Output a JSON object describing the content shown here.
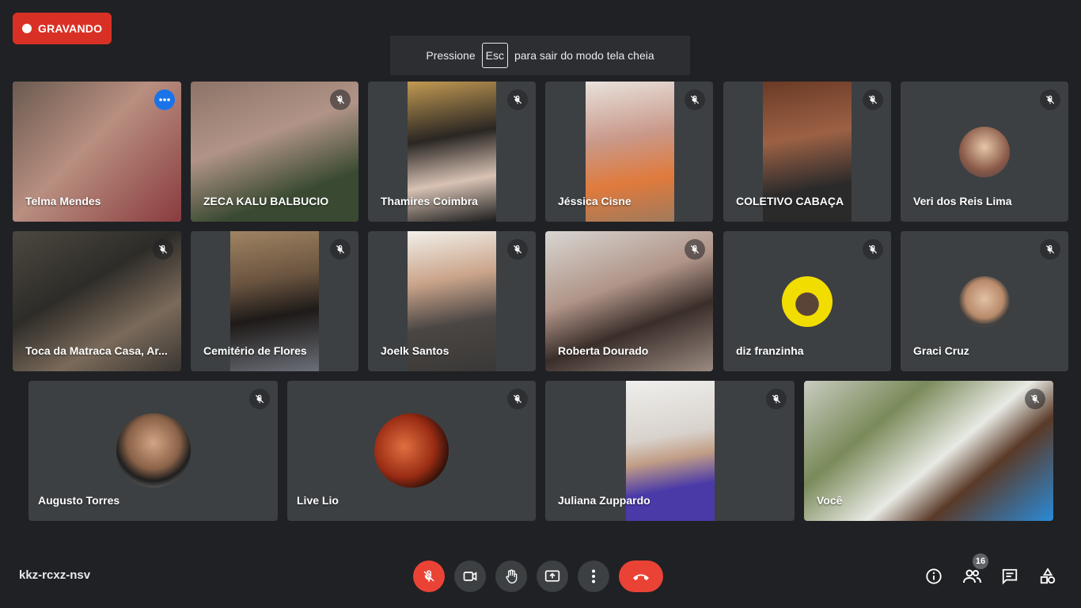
{
  "recording": {
    "label": "GRAVANDO"
  },
  "fullscreen_hint": {
    "before": "Pressione",
    "key": "Esc",
    "after": "para sair do modo tela cheia"
  },
  "participants": [
    {
      "name": "Telma Mendes",
      "muted": false,
      "speaking": true
    },
    {
      "name": "ZECA KALU BALBUCIO",
      "muted": true
    },
    {
      "name": "Thamires Coimbra",
      "muted": true
    },
    {
      "name": "Jéssica Cisne",
      "muted": true
    },
    {
      "name": "COLETIVO CABAÇA",
      "muted": true
    },
    {
      "name": "Veri dos Reis Lima",
      "muted": true
    },
    {
      "name": "Toca da Matraca Casa, Ar...",
      "muted": true
    },
    {
      "name": "Cemitério de Flores",
      "muted": true
    },
    {
      "name": "Joelk Santos",
      "muted": true
    },
    {
      "name": "Roberta Dourado",
      "muted": true
    },
    {
      "name": "diz franzinha",
      "muted": true
    },
    {
      "name": "Graci Cruz",
      "muted": true
    },
    {
      "name": "Augusto Torres",
      "muted": true
    },
    {
      "name": "Live Lio",
      "muted": true
    },
    {
      "name": "Juliana Zuppardo",
      "muted": true
    },
    {
      "name": "Você",
      "muted": true
    }
  ],
  "meeting": {
    "code": "kkz-rcxz-nsv"
  },
  "people_count": "16",
  "colors": {
    "record": "#d93025",
    "end_call": "#ea4335",
    "active_border": "#8ab4f8",
    "tile": "#3c4043",
    "background": "#202124"
  },
  "icons": [
    "mic-off-icon",
    "camera-icon",
    "raise-hand-icon",
    "present-screen-icon",
    "more-options-icon",
    "end-call-icon",
    "info-icon",
    "people-icon",
    "chat-icon",
    "activities-icon"
  ]
}
